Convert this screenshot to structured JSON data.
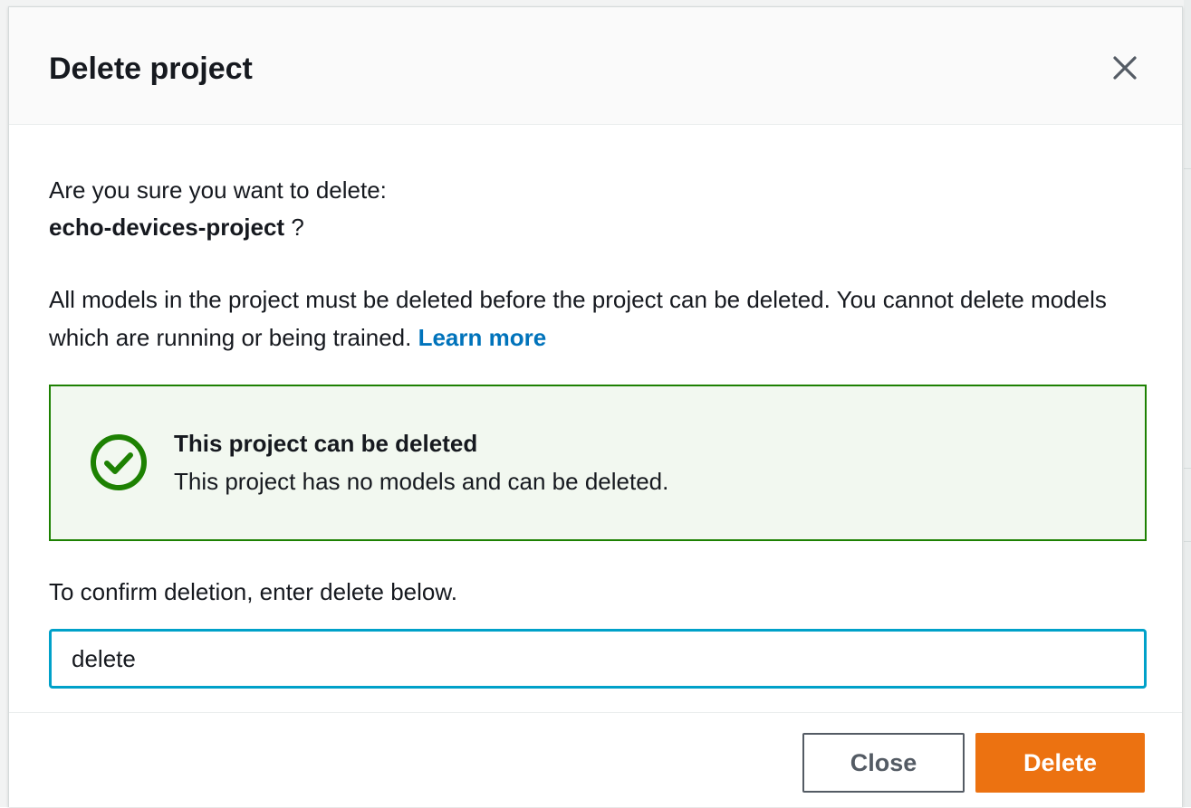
{
  "modal": {
    "title": "Delete project",
    "confirm_question": "Are you sure you want to delete:",
    "project_name": "echo-devices-project",
    "project_suffix": " ?",
    "info_text": "All models in the project must be deleted before the project can be deleted. You cannot delete models which are running or being trained. ",
    "learn_more": "Learn more",
    "alert": {
      "status": "success",
      "icon": "check-circle-icon",
      "title": "This project can be deleted",
      "message": "This project has no models and can be deleted."
    },
    "confirm_label": "To confirm deletion, enter delete below.",
    "confirm_input_value": "delete",
    "buttons": {
      "close": "Close",
      "delete": "Delete"
    }
  },
  "colors": {
    "link": "#0073bb",
    "success": "#1d8102",
    "success_bg": "#f2f8f0",
    "input_focus": "#00a1c9",
    "primary_button": "#ec7211",
    "secondary_button_border": "#545b64"
  }
}
